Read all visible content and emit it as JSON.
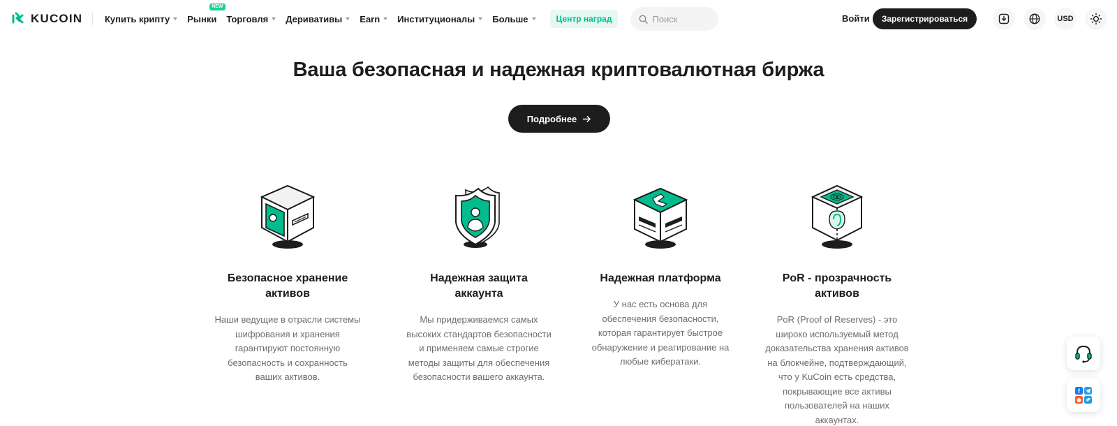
{
  "brand": {
    "name": "KUCOIN",
    "accent": "#01bc8d"
  },
  "nav": {
    "items": [
      {
        "label": "Купить крипту",
        "dropdown": true
      },
      {
        "label": "Рынки",
        "badge": "NEW",
        "dropdown": false
      },
      {
        "label": "Торговля",
        "dropdown": true
      },
      {
        "label": "Деривативы",
        "dropdown": true
      },
      {
        "label": "Earn",
        "dropdown": true
      },
      {
        "label": "Институционалы",
        "dropdown": true
      },
      {
        "label": "Больше",
        "dropdown": true
      }
    ],
    "rewards": "Центр наград",
    "search_placeholder": "Поиск",
    "login": "Войти",
    "register": "Зарегистрироваться",
    "currency": "USD",
    "icons": [
      "download-icon",
      "globe-icon",
      "sun-icon"
    ]
  },
  "hero": {
    "title": "Ваша безопасная и надежная криптовалютная биржа",
    "cta": "Подробнее"
  },
  "features": [
    {
      "icon": "safe-storage-icon",
      "title": "Безопасное хранение активов",
      "text": "Наши ведущие в отрасли системы шифрования и хранения гарантируют постоянную безопасность и сохранность ваших активов."
    },
    {
      "icon": "shield-user-icon",
      "title": "Надежная защита аккаунта",
      "text": "Мы придерживаемся самых высоких стандартов безопасности и применяем самые строгие методы защиты для обеспечения безопасности вашего аккаунта."
    },
    {
      "icon": "platform-server-icon",
      "title": "Надежная платформа",
      "text": "У нас есть основа для обеспечения безопасности, которая гарантирует быстрое обнаружение и реагирование на любые кибератаки."
    },
    {
      "icon": "por-fingerprint-icon",
      "title": "PoR - прозрачность активов",
      "text": "PoR (Proof of Reserves) - это широко используемый метод доказательства хранения активов на блокчейне, подтверждающий, что у KuCoin есть средства, покрывающие все активы пользователей на наших аккаунтах."
    }
  ],
  "widgets": [
    "support-headset-icon",
    "social-links-icon"
  ]
}
